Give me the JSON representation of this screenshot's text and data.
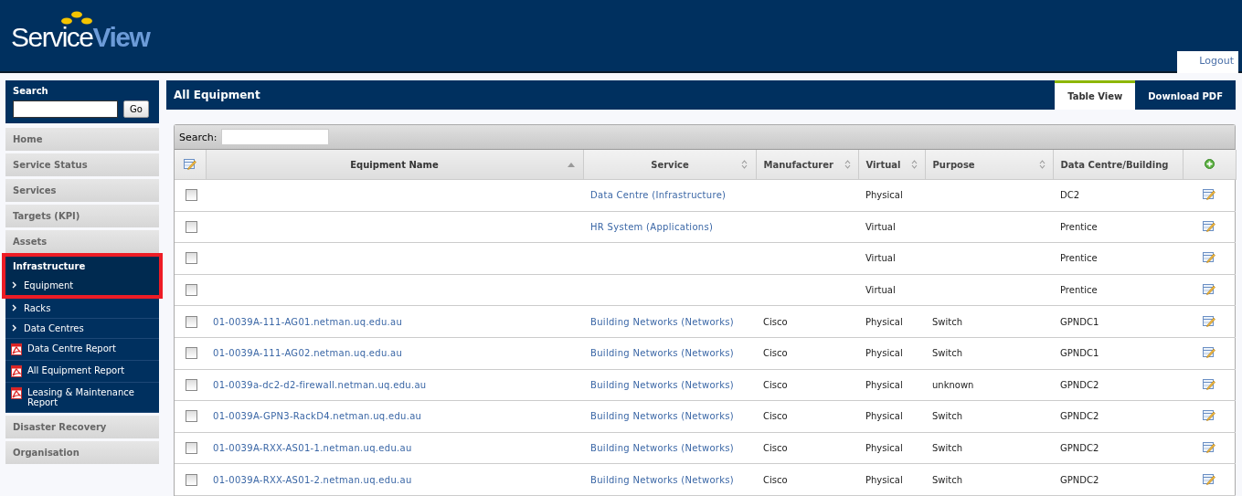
{
  "header": {
    "logo_first": "Service",
    "logo_second": "View",
    "logout": "Logout"
  },
  "sidebar": {
    "search": {
      "title": "Search",
      "button": "Go"
    },
    "items": [
      {
        "label": "Home",
        "kind": "nav"
      },
      {
        "label": "Service Status",
        "kind": "nav"
      },
      {
        "label": "Services",
        "kind": "nav"
      },
      {
        "label": "Targets (KPI)",
        "kind": "nav"
      },
      {
        "label": "Assets",
        "kind": "nav",
        "children": [
          {
            "label": "Infrastructure",
            "kind": "heading",
            "highlighted": true
          },
          {
            "label": "Equipment",
            "kind": "link",
            "highlighted": true
          },
          {
            "label": "Racks",
            "kind": "link",
            "highlighted": false
          },
          {
            "label": "Data Centres",
            "kind": "link",
            "highlighted": false
          },
          {
            "label": "Data Centre Report",
            "kind": "report",
            "highlighted": false
          },
          {
            "label": "All Equipment Report",
            "kind": "report",
            "highlighted": false
          },
          {
            "label": "Leasing & Maintenance Report",
            "kind": "report",
            "highlighted": false
          }
        ]
      },
      {
        "label": "Disaster Recovery",
        "kind": "nav"
      },
      {
        "label": "Organisation",
        "kind": "nav"
      }
    ]
  },
  "main": {
    "title": "All Equipment",
    "tabs": [
      {
        "label": "Table View",
        "selected": true
      },
      {
        "label": "Download PDF",
        "selected": false
      }
    ],
    "table": {
      "search_label": "Search:",
      "columns": [
        {
          "label": "Equipment Name",
          "sortable": true,
          "sorted": true
        },
        {
          "label": "Service",
          "sortable": true,
          "sorted": false
        },
        {
          "label": "Manufacturer",
          "sortable": true,
          "sorted": false
        },
        {
          "label": "Virtual",
          "sortable": true,
          "sorted": false
        },
        {
          "label": "Purpose",
          "sortable": true,
          "sorted": false
        },
        {
          "label": "Data Centre/Building",
          "sortable": false,
          "sorted": false
        }
      ],
      "rows": [
        {
          "checked": false,
          "service": "Data Centre (Infrastructure)",
          "virtual": "Physical",
          "data_centre": "DC2"
        },
        {
          "checked": false,
          "service": "HR System (Applications)",
          "virtual": "Virtual",
          "data_centre": "Prentice"
        },
        {
          "checked": false,
          "virtual": "Virtual",
          "data_centre": "Prentice"
        },
        {
          "checked": false,
          "virtual": "Virtual",
          "data_centre": "Prentice"
        },
        {
          "checked": false,
          "name": "01-0039A-111-AG01.netman.uq.edu.au",
          "service": "Building Networks (Networks)",
          "manufacturer": "Cisco",
          "virtual": "Physical",
          "purpose": "Switch",
          "data_centre": "GPNDC1"
        },
        {
          "checked": false,
          "name": "01-0039A-111-AG02.netman.uq.edu.au",
          "service": "Building Networks (Networks)",
          "manufacturer": "Cisco",
          "virtual": "Physical",
          "purpose": "Switch",
          "data_centre": "GPNDC1"
        },
        {
          "checked": false,
          "name": "01-0039a-dc2-d2-firewall.netman.uq.edu.au",
          "service": "Building Networks (Networks)",
          "manufacturer": "Cisco",
          "virtual": "Physical",
          "purpose": "unknown",
          "data_centre": "GPNDC2"
        },
        {
          "checked": false,
          "name": "01-0039A-GPN3-RackD4.netman.uq.edu.au",
          "service": "Building Networks (Networks)",
          "manufacturer": "Cisco",
          "virtual": "Physical",
          "purpose": "Switch",
          "data_centre": "GPNDC2"
        },
        {
          "checked": false,
          "name": "01-0039A-RXX-AS01-1.netman.uq.edu.au",
          "service": "Building Networks (Networks)",
          "manufacturer": "Cisco",
          "virtual": "Physical",
          "purpose": "Switch",
          "data_centre": "GPNDC2"
        },
        {
          "checked": false,
          "name": "01-0039A-RXX-AS01-2.netman.uq.edu.au",
          "service": "Building Networks (Networks)",
          "manufacturer": "Cisco",
          "virtual": "Physical",
          "purpose": "Switch",
          "data_centre": "GPNDC2"
        }
      ]
    }
  }
}
